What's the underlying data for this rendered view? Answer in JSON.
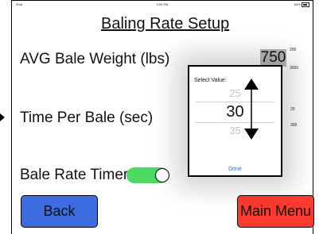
{
  "status_bar": {
    "left": "iPad",
    "time": "3:09 PM",
    "battery": "63%"
  },
  "header": {
    "title": "Baling Rate Setup"
  },
  "fields": {
    "bale_weight": {
      "label": "AVG Bale Weight (lbs)",
      "value": "750",
      "range_max": "200",
      "range_min": "3000"
    },
    "time_per_bale": {
      "label": "Time Per Bale (sec)",
      "range_max": "20",
      "range_min": "300"
    },
    "bale_rate_timer": {
      "label": "Bale Rate Timer",
      "enabled": true
    }
  },
  "picker": {
    "title": "Select Value:",
    "prev_value": "25",
    "selected_value": "30",
    "next_value": "35",
    "done_label": "Done"
  },
  "buttons": {
    "back": "Back",
    "main_menu": "Main Menu"
  },
  "colors": {
    "toggle_on": "#4cd964",
    "back_button": "#3c6ce0",
    "main_menu_button": "#ff3b30",
    "done_link": "#1e6fe0"
  }
}
